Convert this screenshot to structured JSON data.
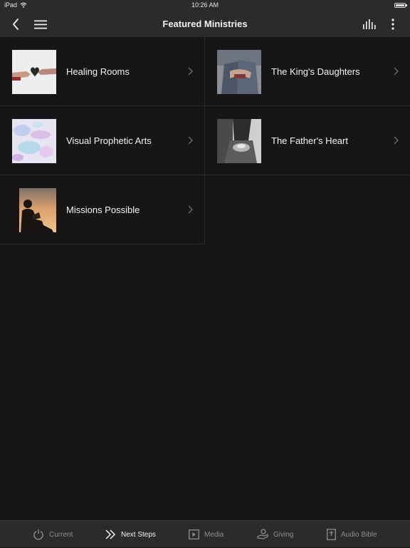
{
  "status_bar": {
    "device": "iPad",
    "time": "10:26 AM"
  },
  "nav": {
    "title": "Featured Ministries",
    "icons": [
      "back-icon",
      "hamburger-menu-icon",
      "equalizer-icon",
      "more-vertical-icon"
    ]
  },
  "ministries": [
    {
      "label": "Healing Rooms",
      "thumbnail": "hands-heart-photo"
    },
    {
      "label": "The King's Daughters",
      "thumbnail": "embracing-couple-photo"
    },
    {
      "label": "Visual Prophetic Arts",
      "thumbnail": "watercolor-abstract-photo"
    },
    {
      "label": "The Father's Heart",
      "thumbnail": "woman-holding-cup-photo"
    },
    {
      "label": "Missions Possible",
      "thumbnail": "reading-silhouette-sunset-photo"
    }
  ],
  "tabs": [
    {
      "label": "Current",
      "icon": "power-icon"
    },
    {
      "label": "Next Steps",
      "icon": "double-chevron-icon",
      "active": true
    },
    {
      "label": "Media",
      "icon": "play-square-icon"
    },
    {
      "label": "Giving",
      "icon": "giving-hand-icon"
    },
    {
      "label": "Audio Bible",
      "icon": "bible-cross-icon"
    }
  ],
  "colors": {
    "background": "#161618",
    "bar": "#2b2b2d",
    "divider": "#2c2c2e",
    "active_tab": "#f2f2f2",
    "inactive_tab": "#8e8e92"
  }
}
